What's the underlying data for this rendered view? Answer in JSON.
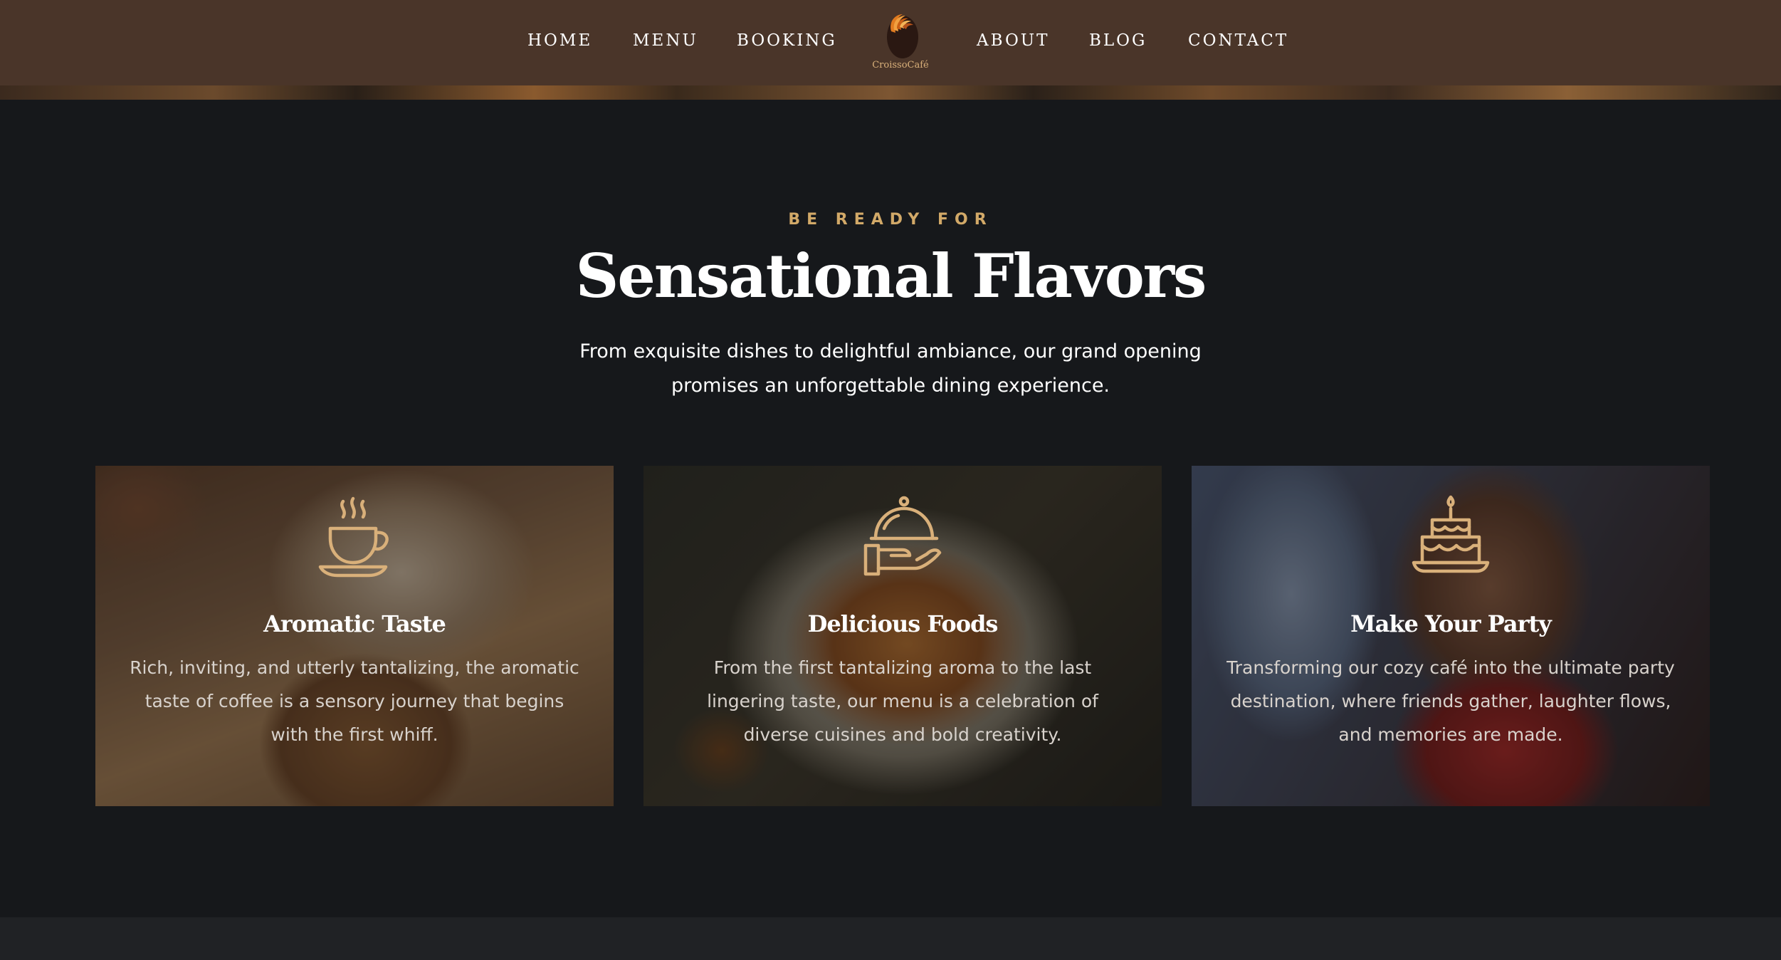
{
  "nav": {
    "items": [
      {
        "label": "HOME"
      },
      {
        "label": "MENU"
      },
      {
        "label": "BOOKING"
      },
      {
        "label": "ABOUT"
      },
      {
        "label": "BLOG"
      },
      {
        "label": "CONTACT"
      }
    ],
    "logo_text": "CroissoCafé"
  },
  "section": {
    "eyebrow": "BE READY FOR",
    "title": "Sensational Flavors",
    "subtitle": "From exquisite dishes to delightful ambiance, our grand opening promises an unforgettable dining experience."
  },
  "cards": [
    {
      "icon": "coffee-cup-icon",
      "title": "Aromatic Taste",
      "text": "Rich, inviting, and utterly tantalizing, the aromatic taste of coffee is a sensory journey that begins with the first whiff."
    },
    {
      "icon": "serving-cloche-icon",
      "title": "Delicious Foods",
      "text": "From the first tantalizing aroma to the last lingering taste, our menu is a celebration of diverse cuisines and bold creativity."
    },
    {
      "icon": "birthday-cake-icon",
      "title": "Make Your Party",
      "text": "Transforming our cozy café into the ultimate party destination, where friends gather, laughter flows, and memories are made."
    }
  ],
  "colors": {
    "header_bg": "#4a3529",
    "page_bg": "#16181b",
    "accent_gold": "#d2a968",
    "footer_bg": "#202225"
  }
}
